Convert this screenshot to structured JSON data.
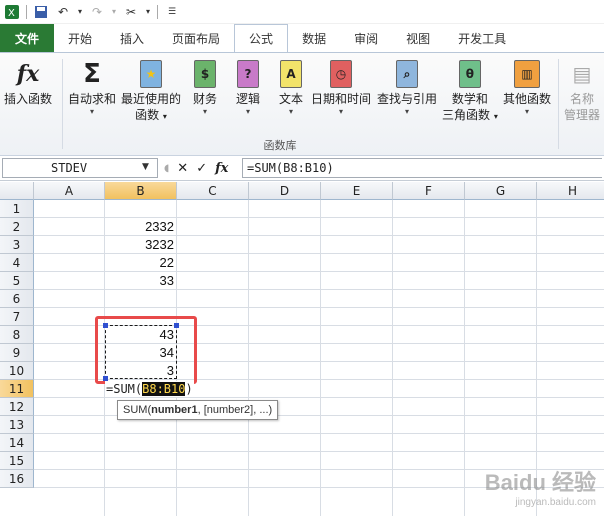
{
  "quick_access": {
    "icons": [
      "excel-logo-icon",
      "save-icon",
      "undo-icon",
      "redo-icon",
      "customize-icon"
    ]
  },
  "tabs": [
    {
      "label": "文件",
      "active": false,
      "file": true
    },
    {
      "label": "开始",
      "active": false
    },
    {
      "label": "插入",
      "active": false
    },
    {
      "label": "页面布局",
      "active": false
    },
    {
      "label": "公式",
      "active": true
    },
    {
      "label": "数据",
      "active": false
    },
    {
      "label": "审阅",
      "active": false
    },
    {
      "label": "视图",
      "active": false
    },
    {
      "label": "开发工具",
      "active": false
    }
  ],
  "ribbon": {
    "insert_function": "插入函数",
    "autosum": "自动求和",
    "recent_line1": "最近使用的",
    "recent_line2": "函数",
    "financial": "财务",
    "logical": "逻辑",
    "text": "文本",
    "datetime": "日期和时间",
    "lookup": "查找与引用",
    "math_line1": "数学和",
    "math_line2": "三角函数",
    "other": "其他函数",
    "name_mgr_line1": "名称",
    "name_mgr_line2": "管理器",
    "group_label": "函数库"
  },
  "formula_bar": {
    "name_box": "STDEV",
    "formula": "=SUM(B8:B10)"
  },
  "grid": {
    "columns": [
      "A",
      "B",
      "C",
      "D",
      "E",
      "F",
      "G",
      "H"
    ],
    "rows": [
      "1",
      "2",
      "3",
      "4",
      "5",
      "6",
      "7",
      "8",
      "9",
      "10",
      "11",
      "12",
      "13",
      "14",
      "15",
      "16"
    ],
    "cells": {
      "B2": "2332",
      "B3": "3232",
      "B4": "22",
      "B5": "33",
      "B8": "43",
      "B9": "34",
      "B10": "3"
    },
    "selected_column": "B",
    "selected_row": "11",
    "edit_prefix": "=SUM(",
    "edit_range": "B8:B10",
    "edit_suffix": ")"
  },
  "tooltip": {
    "fn": "SUM(",
    "arg1": "number1",
    "rest": ", [number2], ...)"
  },
  "watermark": {
    "line1": "Baidu 经验",
    "line2": "jingyan.baidu.com"
  }
}
